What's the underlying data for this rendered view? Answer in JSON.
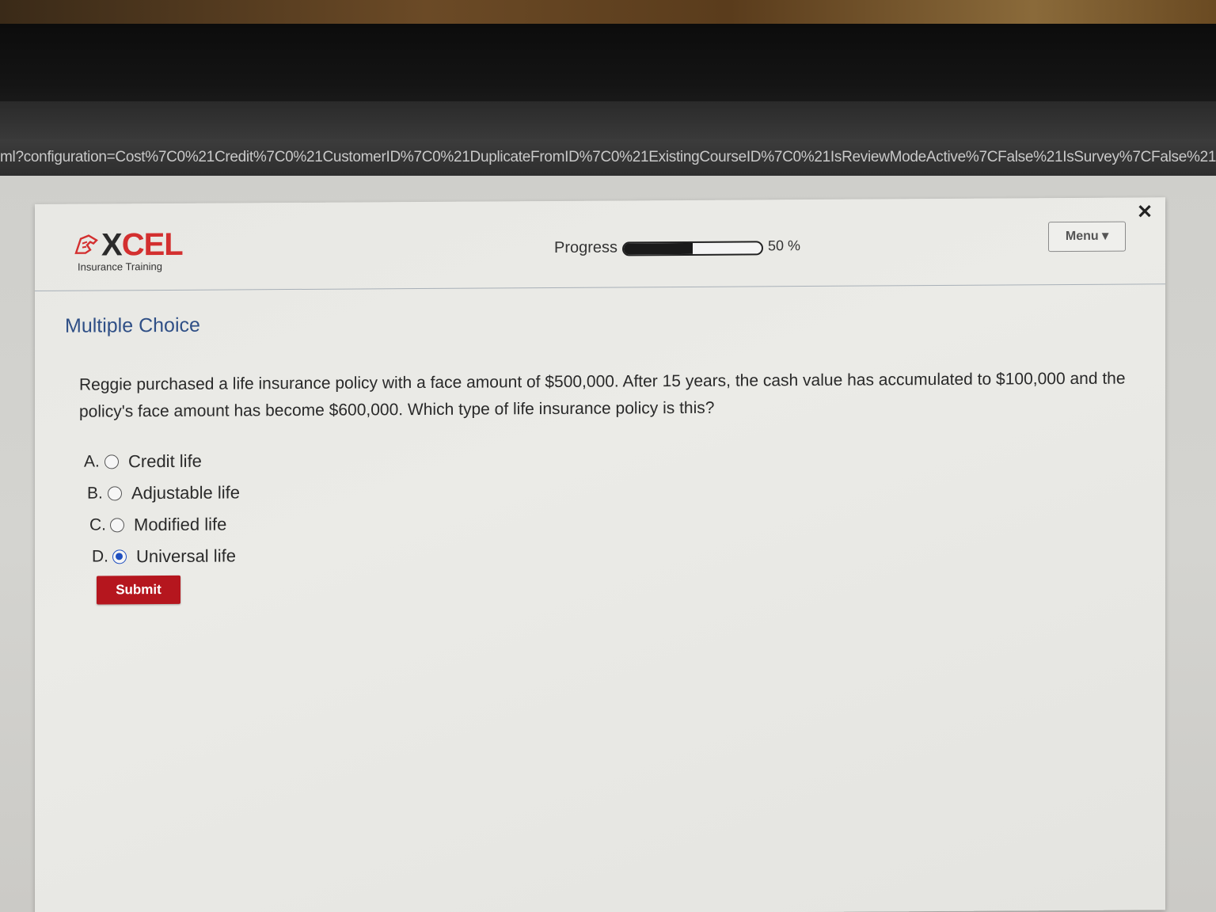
{
  "browser": {
    "url": "ml?configuration=Cost%7C0%21Credit%7C0%21CustomerID%7C0%21DuplicateFromID%7C0%21ExistingCourseID%7C0%21IsReviewModeActive%7CFalse%21IsSurvey%7CFalse%21Keywo"
  },
  "header": {
    "logo_word_x": "X",
    "logo_word_rest": "CEL",
    "logo_subtitle": "Insurance Training",
    "progress_label": "Progress",
    "progress_value": 0.5,
    "progress_text": "50 %",
    "menu_label": "Menu ▾",
    "close_glyph": "✕"
  },
  "main": {
    "section_title": "Multiple Choice",
    "question": "Reggie purchased a life insurance policy with a face amount of $500,000. After 15 years, the cash value has accumulated to $100,000 and the policy's face amount has become $600,000. Which type of life insurance policy is this?",
    "options": [
      {
        "letter": "A.",
        "text": "Credit life",
        "selected": false
      },
      {
        "letter": "B.",
        "text": "Adjustable life",
        "selected": false
      },
      {
        "letter": "C.",
        "text": "Modified life",
        "selected": false
      },
      {
        "letter": "D.",
        "text": "Universal life",
        "selected": true
      }
    ],
    "submit_label": "Submit"
  },
  "colors": {
    "brand_red": "#d32f2f",
    "submit_red": "#b5161e",
    "title_blue": "#2f4f86",
    "radio_selected": "#1f4fbf"
  }
}
